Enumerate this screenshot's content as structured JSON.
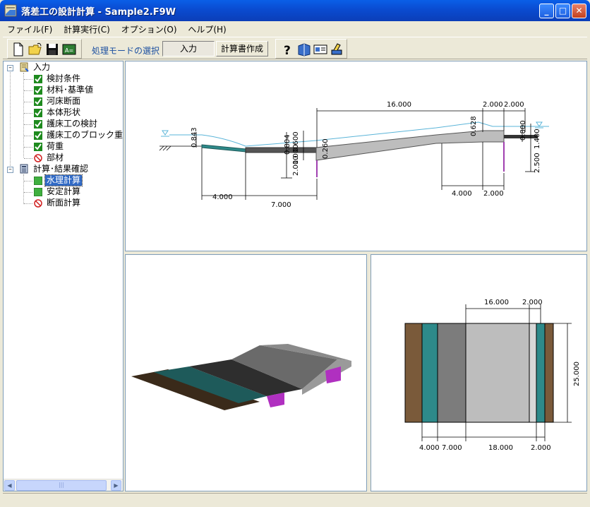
{
  "window": {
    "title": "落差工の設計計算 - Sample2.F9W",
    "buttons": {
      "minimize": "_",
      "maximize": "□",
      "close": "✕"
    }
  },
  "menubar": {
    "items": [
      "ファイル(F)",
      "計算実行(C)",
      "オプション(O)",
      "ヘルプ(H)"
    ]
  },
  "toolbar": {
    "file_buttons": [
      "new-file-icon",
      "open-folder-icon",
      "save-icon",
      "export-icon"
    ],
    "mode_label": "処理モードの選択",
    "mode_input": "入力",
    "mode_report": "計算書作成",
    "help_buttons": [
      "help-icon",
      "book-icon",
      "card-icon",
      "print-icon"
    ]
  },
  "tree": {
    "root_input": {
      "label": "入力",
      "children": [
        {
          "label": "検討条件",
          "status": "checked"
        },
        {
          "label": "材料･基準値",
          "status": "checked"
        },
        {
          "label": "河床断面",
          "status": "checked"
        },
        {
          "label": "本体形状",
          "status": "checked"
        },
        {
          "label": "護床工の検討",
          "status": "checked"
        },
        {
          "label": "護床工のブロック重量",
          "status": "checked"
        },
        {
          "label": "荷重",
          "status": "checked"
        },
        {
          "label": "部材",
          "status": "prohibited"
        }
      ]
    },
    "root_calc": {
      "label": "計算･結果確認",
      "children": [
        {
          "label": "水理計算",
          "status": "green",
          "selected": true
        },
        {
          "label": "安定計算",
          "status": "green"
        },
        {
          "label": "断面計算",
          "status": "prohibited"
        }
      ]
    },
    "scrollbar": {
      "left": "◀",
      "right": "▶",
      "thumb": "|||"
    }
  },
  "section_view": {
    "dims": {
      "top_16": "16.000",
      "top_2a": "2.000",
      "top_2b": "2.000",
      "left_0843": "0.843",
      "left_0804": "0.804",
      "left_0600": "0.600",
      "left_1000": "1.000",
      "left_2000": "2.000",
      "left_0260": "0.260",
      "right_0628": "0.628",
      "right_0800": "0.800",
      "right_1400": "1.400",
      "right_2500": "2.500",
      "bot_4000a": "4.000",
      "bot_7000": "7.000",
      "bot_4000b": "4.000",
      "bot_2000": "2.000"
    }
  },
  "plan_view": {
    "dims": {
      "top_16": "16.000",
      "top_2": "2.000",
      "right_25": "25.000",
      "bot_4": "4.000",
      "bot_7": "7.000",
      "bot_18": "18.000",
      "bot_2": "2.000"
    }
  },
  "colors": {
    "titlebar": "#0A4BD0",
    "selection": "#316AC5",
    "check_green": "#1E8A1E",
    "brown": "#7A5A3A",
    "teal": "#2E8A8A",
    "gray_dark": "#7C7C7C",
    "gray_light": "#BDBDBD",
    "magenta": "#A040B0",
    "water_line": "#5AB4D8"
  }
}
